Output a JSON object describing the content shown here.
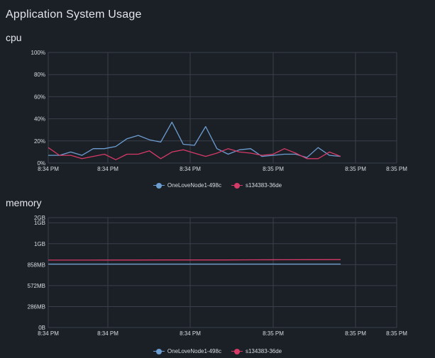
{
  "page": {
    "title": "Application System Usage"
  },
  "colors": {
    "series_1": "#6d9ed2",
    "series_2": "#d63a67",
    "grid": "#3a404a"
  },
  "chart_data": [
    {
      "id": "cpu",
      "title": "cpu",
      "type": "line",
      "ylabels": [
        "0%",
        "20%",
        "40%",
        "60%",
        "80%",
        "100%"
      ],
      "ylim": [
        0,
        100
      ],
      "xlabels": [
        "8:34 PM",
        "8:34 PM",
        "8:34 PM",
        "8:35 PM",
        "8:35 PM",
        "8:35 PM"
      ],
      "legend_position": "bottom",
      "series": [
        {
          "name": "OneLoveNode1-498c",
          "values": [
            7,
            7,
            10,
            7,
            13,
            13,
            15,
            22,
            25,
            21,
            19,
            37,
            17,
            16,
            33,
            13,
            8,
            12,
            13,
            6,
            7,
            8,
            8,
            5,
            14,
            7,
            6
          ]
        },
        {
          "name": "s134383-36de",
          "values": [
            14,
            7,
            7,
            4,
            6,
            8,
            3,
            8,
            8,
            11,
            4,
            10,
            12,
            9,
            6,
            9,
            13,
            10,
            9,
            7,
            8,
            13,
            9,
            4,
            4,
            10,
            6
          ]
        }
      ]
    },
    {
      "id": "memory",
      "title": "memory",
      "type": "line",
      "ylabels": [
        "0B",
        "286MB",
        "572MB",
        "858MB",
        "1GB",
        "1GB",
        "2GB"
      ],
      "ylim": [
        0,
        1.5
      ],
      "xlabels": [
        "8:34 PM",
        "8:34 PM",
        "8:34 PM",
        "8:35 PM",
        "8:35 PM",
        "8:35 PM"
      ],
      "legend_position": "bottom",
      "series": [
        {
          "name": "OneLoveNode1-498c",
          "values": [
            0.866,
            0.866,
            0.866,
            0.866,
            0.866,
            0.866,
            0.866,
            0.866,
            0.866,
            0.866,
            0.866
          ]
        },
        {
          "name": "s134383-36de",
          "values": [
            0.92,
            0.92,
            0.921,
            0.921,
            0.922,
            0.922,
            0.922,
            0.924,
            0.925,
            0.926,
            0.927
          ]
        }
      ]
    }
  ]
}
